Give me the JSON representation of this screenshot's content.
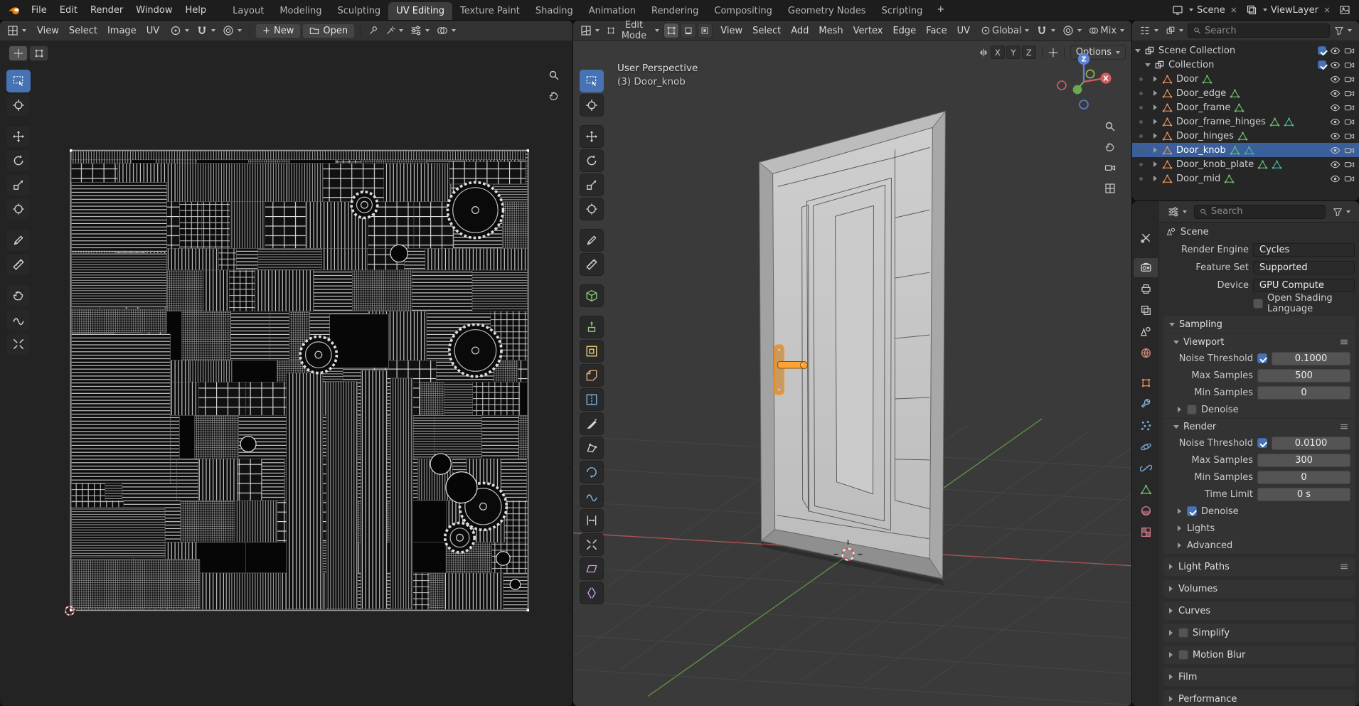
{
  "colors": {
    "accent": "#4772b3",
    "selection": "#3a5f9b",
    "knob_orange": "#ffa133",
    "object_orange": "#e8935c",
    "mesh_green": "#6fbf6f"
  },
  "topbar": {
    "menus": [
      "File",
      "Edit",
      "Render",
      "Window",
      "Help"
    ],
    "workspaces": [
      {
        "label": "Layout"
      },
      {
        "label": "Modeling"
      },
      {
        "label": "Sculpting"
      },
      {
        "label": "UV Editing",
        "active": true
      },
      {
        "label": "Texture Paint"
      },
      {
        "label": "Shading"
      },
      {
        "label": "Animation"
      },
      {
        "label": "Rendering"
      },
      {
        "label": "Compositing"
      },
      {
        "label": "Geometry Nodes"
      },
      {
        "label": "Scripting"
      }
    ],
    "add_workspace": "+",
    "scene_label": "Scene",
    "viewlayer_label": "ViewLayer",
    "remove_glyph": "×"
  },
  "uv_editor": {
    "menus": [
      "View",
      "Select",
      "Image",
      "UV"
    ],
    "plus_glyph": "+",
    "new_label": "New",
    "open_label": "Open"
  },
  "viewport": {
    "mode_label": "Edit Mode",
    "menus": [
      "View",
      "Select",
      "Add",
      "Mesh",
      "Vertex",
      "Edge",
      "Face",
      "UV"
    ],
    "orientation_label": "Global",
    "mix_label": "Mix",
    "options_label": "Options",
    "mirror_axes": [
      "X",
      "Y",
      "Z"
    ],
    "overlay_line1": "User Perspective",
    "overlay_line2": "(3) Door_knob",
    "gizmo": {
      "z_label": "Z",
      "x_label": "X"
    }
  },
  "tools_uv": [
    {
      "name": "tool-select-box",
      "icon": "#s-selbox",
      "active": true
    },
    {
      "name": "tool-cursor",
      "icon": "#s-cursor"
    },
    {
      "name": "tool-move",
      "icon": "#s-move",
      "gap": true
    },
    {
      "name": "tool-rotate",
      "icon": "#s-rot"
    },
    {
      "name": "tool-scale",
      "icon": "#s-scale"
    },
    {
      "name": "tool-transform",
      "icon": "#s-xform"
    },
    {
      "name": "tool-annotate",
      "icon": "#s-pen",
      "gap": true
    },
    {
      "name": "tool-measure",
      "icon": "#s-measure"
    },
    {
      "name": "tool-grab",
      "icon": "#s-hand",
      "gap": true
    },
    {
      "name": "tool-relax",
      "icon": "#s-smooth"
    },
    {
      "name": "tool-pinch",
      "icon": "#s-shrink"
    }
  ],
  "tools_3d": [
    {
      "name": "tool-select-box",
      "icon": "#s-selbox",
      "active": true
    },
    {
      "name": "tool-cursor",
      "icon": "#s-cursor"
    },
    {
      "name": "tool-move",
      "icon": "#s-move",
      "gap": true
    },
    {
      "name": "tool-rotate",
      "icon": "#s-rot"
    },
    {
      "name": "tool-scale",
      "icon": "#s-scale"
    },
    {
      "name": "tool-transform",
      "icon": "#s-xform"
    },
    {
      "name": "tool-annotate",
      "icon": "#s-pen",
      "gap": true
    },
    {
      "name": "tool-measure",
      "icon": "#s-measure"
    },
    {
      "name": "tool-add-cube",
      "icon": "#s-cube",
      "gap": true,
      "color": "#8fcf7a"
    },
    {
      "name": "tool-extrude",
      "icon": "#s-extrude",
      "gap": true,
      "color": "#8fcf7a"
    },
    {
      "name": "tool-inset-faces",
      "icon": "#s-inset",
      "color": "#e8d47a"
    },
    {
      "name": "tool-bevel",
      "icon": "#s-bevel",
      "color": "#e8b07a"
    },
    {
      "name": "tool-loop-cut",
      "icon": "#s-loop",
      "color": "#7ab8e8"
    },
    {
      "name": "tool-knife",
      "icon": "#s-knife"
    },
    {
      "name": "tool-poly-build",
      "icon": "#s-poly"
    },
    {
      "name": "tool-spin",
      "icon": "#s-spin",
      "color": "#7ab8e8"
    },
    {
      "name": "tool-smooth",
      "icon": "#s-smooth",
      "color": "#7ab8e8"
    },
    {
      "name": "tool-edge-slide",
      "icon": "#s-slide"
    },
    {
      "name": "tool-shrink-fatten",
      "icon": "#s-shrink"
    },
    {
      "name": "tool-shear",
      "icon": "#s-shear",
      "color": "#c79ae8"
    },
    {
      "name": "tool-rip-region",
      "icon": "#s-rip",
      "color": "#c79ae8"
    }
  ],
  "outliner": {
    "search_placeholder": "Search",
    "scene_collection_label": "Scene Collection",
    "collection_label": "Collection",
    "objects": [
      {
        "name": "Door"
      },
      {
        "name": "Door_edge"
      },
      {
        "name": "Door_frame"
      },
      {
        "name": "Door_frame_hinges",
        "extra": true
      },
      {
        "name": "Door_hinges"
      },
      {
        "name": "Door_knob",
        "selected": true,
        "extra": true
      },
      {
        "name": "Door_knob_plate",
        "extra": true
      },
      {
        "name": "Door_mid"
      }
    ]
  },
  "properties": {
    "search_placeholder": "Search",
    "breadcrumb_label": "Scene",
    "tabs": [
      {
        "name": "tab-tool",
        "icon": "#t-tool",
        "color": "#c9c9c9"
      },
      {
        "name": "tab-render",
        "icon": "#t-render",
        "color": "#d6d6d6",
        "active": true,
        "gap": true
      },
      {
        "name": "tab-output",
        "icon": "#t-output",
        "color": "#c9c9c9"
      },
      {
        "name": "tab-view-layer",
        "icon": "#t-viewlayer",
        "color": "#c9c9c9"
      },
      {
        "name": "tab-scene",
        "icon": "#t-scene",
        "color": "#c9c9c9"
      },
      {
        "name": "tab-world",
        "icon": "#t-world",
        "color": "#d08a7e"
      },
      {
        "name": "tab-object",
        "icon": "#t-object",
        "color": "#e8935c",
        "gap": true
      },
      {
        "name": "tab-modifiers",
        "icon": "#t-modifier",
        "color": "#7aa8d8"
      },
      {
        "name": "tab-particles",
        "icon": "#t-particles",
        "color": "#7aa8d8"
      },
      {
        "name": "tab-physics",
        "icon": "#t-physics",
        "color": "#7aa8d8"
      },
      {
        "name": "tab-constraints",
        "icon": "#t-constraint",
        "color": "#7aa8d8"
      },
      {
        "name": "tab-object-data",
        "icon": "#t-data",
        "color": "#6fbf6f"
      },
      {
        "name": "tab-material",
        "icon": "#t-material",
        "color": "#d8808f"
      },
      {
        "name": "tab-texture",
        "icon": "#t-texture",
        "color": "#d8808f"
      }
    ],
    "render_engine_label": "Render Engine",
    "render_engine": "Cycles",
    "feature_set_label": "Feature Set",
    "feature_set": "Supported",
    "device_label": "Device",
    "device": "GPU Compute",
    "osl_label": "Open Shading Language",
    "sampling": {
      "title": "Sampling",
      "viewport": {
        "title": "Viewport",
        "noise_label": "Noise Threshold",
        "noise": "0.1000",
        "max_label": "Max Samples",
        "max": "500",
        "min_label": "Min Samples",
        "min": "0",
        "denoise_label": "Denoise"
      },
      "render": {
        "title": "Render",
        "noise_label": "Noise Threshold",
        "noise": "0.0100",
        "max_label": "Max Samples",
        "max": "300",
        "min_label": "Min Samples",
        "min": "0",
        "time_label": "Time Limit",
        "time": "0 s",
        "denoise_label": "Denoise"
      },
      "lights_label": "Lights",
      "advanced_label": "Advanced"
    },
    "sections": [
      {
        "name": "section-light-paths",
        "title": "Light Paths",
        "menu": true
      },
      {
        "name": "section-volumes",
        "title": "Volumes"
      },
      {
        "name": "section-curves",
        "title": "Curves"
      },
      {
        "name": "section-simplify",
        "title": "Simplify",
        "checkbox": true
      },
      {
        "name": "section-motion-blur",
        "title": "Motion Blur",
        "checkbox": true
      },
      {
        "name": "section-film",
        "title": "Film"
      },
      {
        "name": "section-performance",
        "title": "Performance"
      }
    ]
  }
}
